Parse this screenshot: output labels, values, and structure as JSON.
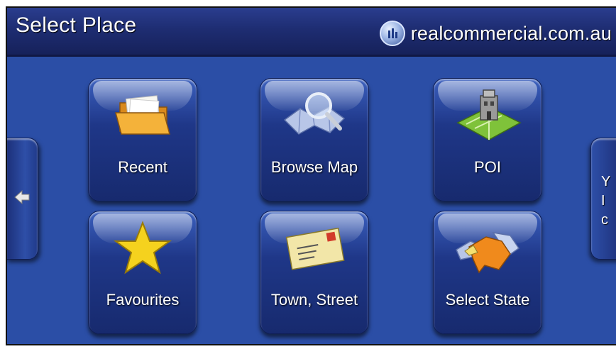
{
  "header": {
    "title": "Select Place",
    "brand": "realcommercial.com.au"
  },
  "tiles": [
    {
      "label": "Recent",
      "icon": "folder-icon"
    },
    {
      "label": "Browse Map",
      "icon": "magnifier-map-icon"
    },
    {
      "label": "POI",
      "icon": "poi-building-icon"
    },
    {
      "label": "Favourites",
      "icon": "star-icon"
    },
    {
      "label": "Town, Street",
      "icon": "envelope-icon"
    },
    {
      "label": "Select State",
      "icon": "state-map-icon"
    }
  ],
  "nav": {
    "left_icon": "arrow-left-icon",
    "right_peek": [
      "Y",
      "I",
      "c"
    ]
  },
  "colors": {
    "background": "#2b4ea6",
    "header": "#1e2d72",
    "tile": "#1f3788"
  }
}
